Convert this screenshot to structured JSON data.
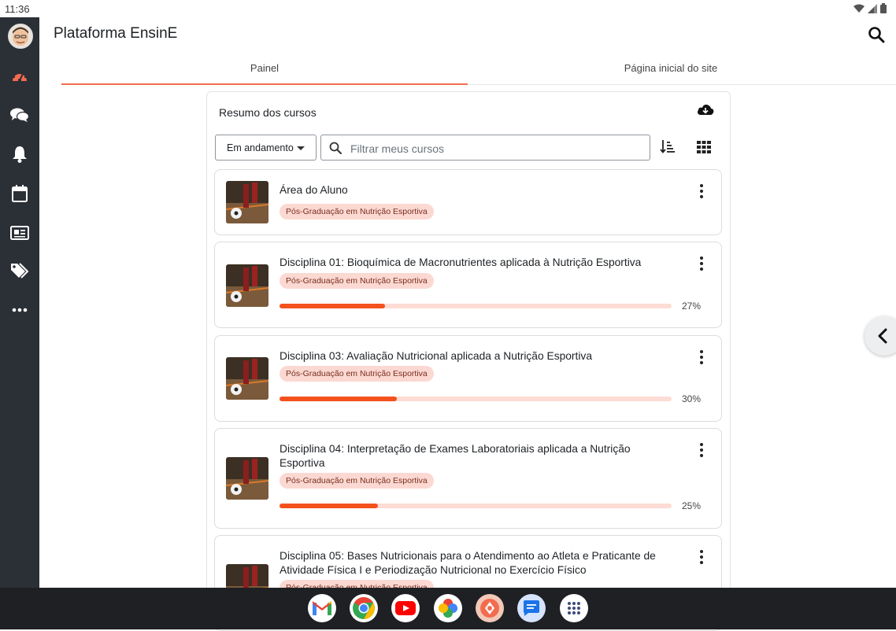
{
  "status_bar": {
    "time": "11:36"
  },
  "header": {
    "title": "Plataforma EnsinE"
  },
  "sidebar": {
    "items": [
      {
        "icon": "dashboard-icon"
      },
      {
        "icon": "messages-icon"
      },
      {
        "icon": "notifications-icon"
      },
      {
        "icon": "calendar-icon"
      },
      {
        "icon": "news-icon"
      },
      {
        "icon": "tags-icon"
      },
      {
        "icon": "more-icon"
      }
    ]
  },
  "tabs": [
    {
      "label": "Painel",
      "active": true
    },
    {
      "label": "Página inicial do site",
      "active": false
    }
  ],
  "course_overview": {
    "title": "Resumo dos cursos",
    "filter_value": "Em andamento",
    "search_placeholder": "Filtrar meus cursos",
    "courses": [
      {
        "title": "Área do Aluno",
        "category": "Pós-Graduação em Nutrição Esportiva",
        "progress": null
      },
      {
        "title": "Disciplina 01: Bioquímica de Macronutrientes aplicada à Nutrição Esportiva",
        "category": "Pós-Graduação em Nutrição Esportiva",
        "progress": 27,
        "progress_label": "27%"
      },
      {
        "title": "Disciplina 03: Avaliação Nutricional aplicada a Nutrição Esportiva",
        "category": "Pós-Graduação em Nutrição Esportiva",
        "progress": 30,
        "progress_label": "30%"
      },
      {
        "title": "Disciplina 04: Interpretação de Exames Laboratoriais aplicada a Nutrição Esportiva",
        "category": "Pós-Graduação em Nutrição Esportiva",
        "progress": 25,
        "progress_label": "25%"
      },
      {
        "title": "Disciplina 05: Bases Nutricionais para o Atendimento ao Atleta e Praticante de Atividade Física I e Periodização Nutricional no Exercício Físico",
        "category": "Pós-Graduação em Nutrição Esportiva",
        "progress": null
      }
    ]
  },
  "colors": {
    "accent": "#f4511e",
    "sidebar": "#2b2f36",
    "badge_bg": "#fbd9d2"
  },
  "taskbar": {
    "apps": [
      "gmail-icon",
      "chrome-icon",
      "youtube-icon",
      "photos-icon",
      "app-icon",
      "messages-app-icon",
      "app-drawer-icon"
    ]
  }
}
